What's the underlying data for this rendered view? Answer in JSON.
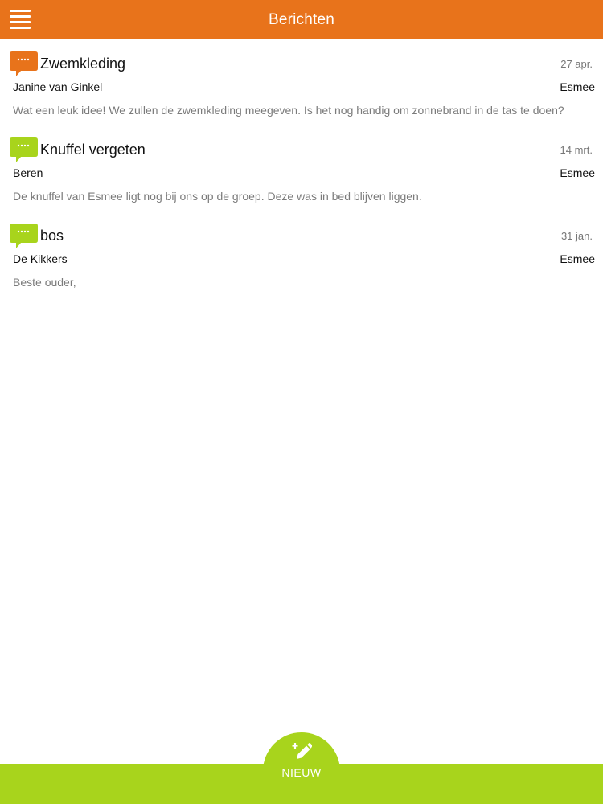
{
  "header": {
    "title": "Berichten",
    "menu_icon": "hamburger-menu-icon",
    "color": "#e8731b"
  },
  "messages": [
    {
      "icon": "chat-bubble-icon",
      "icon_color": "#e8731b",
      "title": "Zwemkleding",
      "date": "27 apr.",
      "from": "Janine van Ginkel",
      "to": "Esmee",
      "preview": "Wat een leuk idee! We zullen de zwemkleding meegeven. Is het nog handig om zonnebrand in de tas te doen?"
    },
    {
      "icon": "chat-bubble-icon",
      "icon_color": "#a8d41c",
      "title": "Knuffel vergeten",
      "date": "14 mrt.",
      "from": "Beren",
      "to": "Esmee",
      "preview": "De knuffel van Esmee ligt nog bij ons op de groep. Deze was in bed blijven liggen."
    },
    {
      "icon": "chat-bubble-icon",
      "icon_color": "#a8d41c",
      "title": "bos",
      "date": "31 jan.",
      "from": "De Kikkers",
      "to": "Esmee",
      "preview": "Beste ouder,"
    }
  ],
  "footer": {
    "new_label": "NIEUW",
    "new_icon": "compose-pencil-icon",
    "color": "#a8d41c"
  }
}
